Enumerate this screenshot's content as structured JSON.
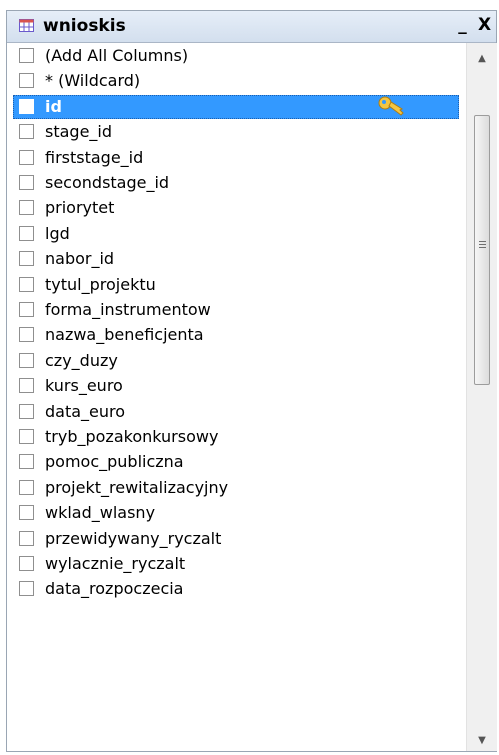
{
  "window": {
    "title": "wnioskis",
    "minimize_label": "_",
    "close_label": "X",
    "title_icon": "table-icon"
  },
  "columns": [
    {
      "label": "(Add All Columns)",
      "checked": false,
      "selected": false
    },
    {
      "label": "* (Wildcard)",
      "checked": false,
      "selected": false
    },
    {
      "label": "id",
      "checked": false,
      "selected": true,
      "primary_key": true
    },
    {
      "label": "stage_id",
      "checked": false,
      "selected": false
    },
    {
      "label": "firststage_id",
      "checked": false,
      "selected": false
    },
    {
      "label": "secondstage_id",
      "checked": false,
      "selected": false
    },
    {
      "label": "priorytet",
      "checked": false,
      "selected": false
    },
    {
      "label": "lgd",
      "checked": false,
      "selected": false
    },
    {
      "label": "nabor_id",
      "checked": false,
      "selected": false
    },
    {
      "label": "tytul_projektu",
      "checked": false,
      "selected": false
    },
    {
      "label": "forma_instrumentow",
      "checked": false,
      "selected": false
    },
    {
      "label": "nazwa_beneficjenta",
      "checked": false,
      "selected": false
    },
    {
      "label": "czy_duzy",
      "checked": false,
      "selected": false
    },
    {
      "label": "kurs_euro",
      "checked": false,
      "selected": false
    },
    {
      "label": "data_euro",
      "checked": false,
      "selected": false
    },
    {
      "label": "tryb_pozakonkursowy",
      "checked": false,
      "selected": false
    },
    {
      "label": "pomoc_publiczna",
      "checked": false,
      "selected": false
    },
    {
      "label": "projekt_rewitalizacyjny",
      "checked": false,
      "selected": false
    },
    {
      "label": "wklad_wlasny",
      "checked": false,
      "selected": false
    },
    {
      "label": "przewidywany_ryczalt",
      "checked": false,
      "selected": false
    },
    {
      "label": "wylacznie_ryczalt",
      "checked": false,
      "selected": false
    },
    {
      "label": "data_rozpoczecia",
      "checked": false,
      "selected": false
    }
  ],
  "key_icon": "key-icon",
  "colors": {
    "selection": "#3399ff",
    "titlebar": "#dbe6f3",
    "key": "#f0c040"
  }
}
